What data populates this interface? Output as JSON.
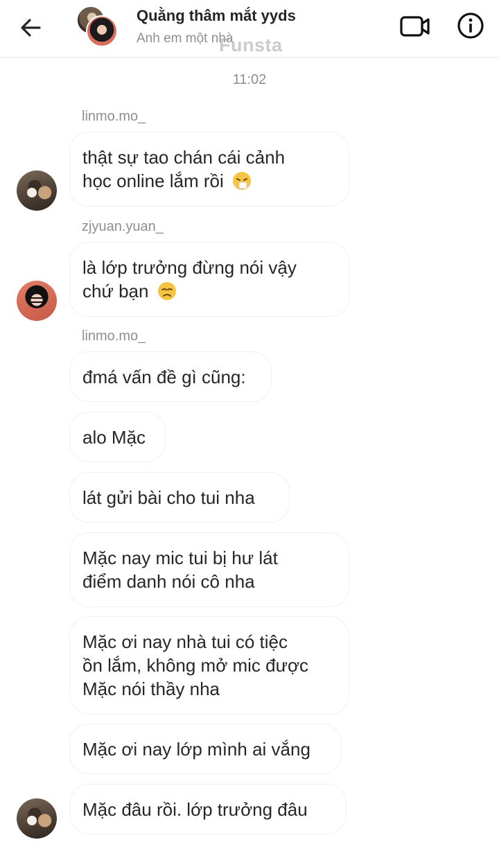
{
  "header": {
    "title": "Quằng thâm mắt yyds",
    "subtitle": "Anh em một nhà",
    "watermark": "Funsta"
  },
  "timestamp": "11:02",
  "messages": [
    {
      "sender": "linmo.mo_",
      "lines": [
        "thật sự tao chán cái cảnh",
        "học online lắm rồi"
      ],
      "emoji": "sneezing-face"
    },
    {
      "sender": "zjyuan.yuan_",
      "lines": [
        "là lớp trưởng đừng nói vậy",
        "chứ bạn"
      ],
      "emoji": "disappointed-face"
    },
    {
      "sender": "linmo.mo_",
      "lines": [
        "đmá vấn đề gì cũng:"
      ]
    },
    {
      "lines": [
        "alo Mặc"
      ]
    },
    {
      "lines": [
        "lát gửi bài cho tui nha"
      ]
    },
    {
      "lines": [
        "Mặc nay mic tui bị hư lát",
        "điểm danh nói cô nha"
      ]
    },
    {
      "lines": [
        "Mặc ơi nay nhà tui có tiệc",
        "ồn lắm, không mở mic được",
        "Mặc nói thầy nha"
      ]
    },
    {
      "lines": [
        "Mặc ơi nay lớp mình ai vắng"
      ]
    },
    {
      "lines": [
        "Mặc đâu rồi. lớp trưởng đâu"
      ]
    }
  ],
  "icons": {
    "back": "arrow-left-icon",
    "video": "video-camera-icon",
    "info": "info-circle-icon"
  }
}
